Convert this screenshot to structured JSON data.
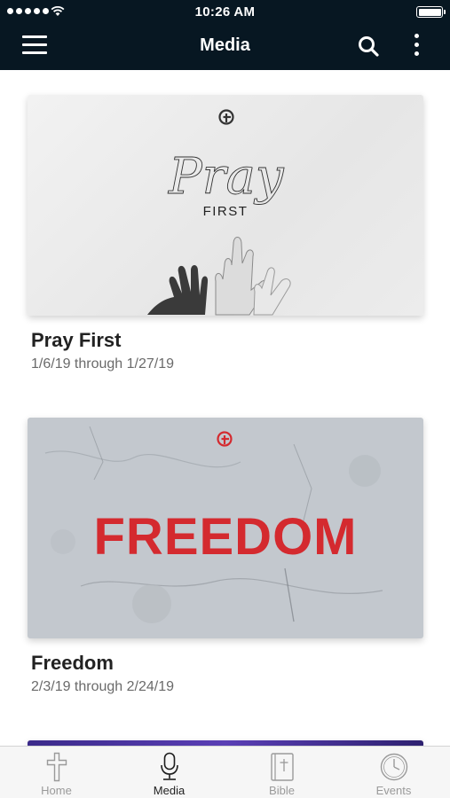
{
  "status_bar": {
    "time": "10:26 AM"
  },
  "header": {
    "title": "Media"
  },
  "series": [
    {
      "title": "Pray First",
      "dates": "1/6/19 through 1/27/19",
      "art_script": "Pray",
      "art_subtitle": "FIRST"
    },
    {
      "title": "Freedom",
      "dates": "2/3/19 through 2/24/19",
      "art_word": "FREEDOM"
    }
  ],
  "tabs": [
    {
      "label": "Home",
      "icon": "cross-icon"
    },
    {
      "label": "Media",
      "icon": "microphone-icon"
    },
    {
      "label": "Bible",
      "icon": "bible-icon"
    },
    {
      "label": "Events",
      "icon": "clock-icon"
    }
  ],
  "active_tab": "Media",
  "colors": {
    "nav_background": "#071722",
    "freedom_red": "#d42a2f",
    "tab_inactive": "#9a9a9a"
  }
}
